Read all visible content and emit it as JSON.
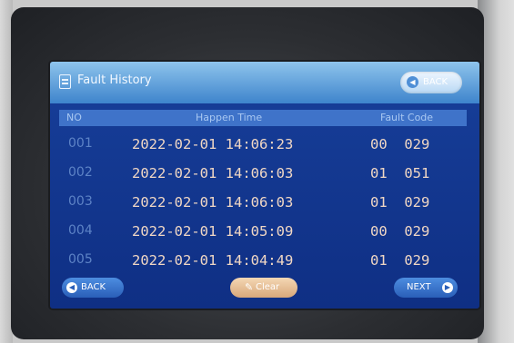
{
  "header": {
    "title": "Fault History",
    "back_label": "BACK"
  },
  "table": {
    "columns": [
      "NO",
      "Happen Time",
      "Fault Code"
    ],
    "rows": [
      {
        "no": "001",
        "time": "2022-02-01  14:06:23",
        "code": "00  029"
      },
      {
        "no": "002",
        "time": "2022-02-01  14:06:03",
        "code": "01  051"
      },
      {
        "no": "003",
        "time": "2022-02-01  14:06:03",
        "code": "01  029"
      },
      {
        "no": "004",
        "time": "2022-02-01  14:05:09",
        "code": "00  029"
      },
      {
        "no": "005",
        "time": "2022-02-01  14:04:49",
        "code": "01  029"
      }
    ]
  },
  "footer": {
    "back_label": "BACK",
    "clear_label": "Clear",
    "next_label": "NEXT"
  },
  "icons": {
    "title": "document-icon",
    "back": "arrow-left-circle-icon",
    "clear": "pencil-icon",
    "next": "arrow-right-circle-icon"
  },
  "colors": {
    "screen_bg": "#143a93",
    "header_bg": "#5fa2dc",
    "row_text": "#f0d7c4",
    "row_number": "#5d83c6"
  }
}
